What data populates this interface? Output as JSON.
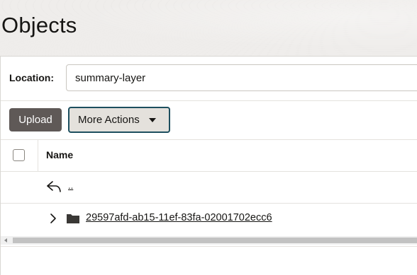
{
  "page": {
    "title": "Objects"
  },
  "location": {
    "label": "Location:",
    "value": "summary-layer"
  },
  "toolbar": {
    "upload_label": "Upload",
    "more_actions_label": "More Actions"
  },
  "table": {
    "columns": [
      "Name"
    ],
    "rows": [
      {
        "type": "parent",
        "name": ".."
      },
      {
        "type": "folder",
        "name": "29597afd-ab15-11ef-83fa-02001702ecc6"
      }
    ]
  },
  "icons": {
    "back": "back-arrow-icon",
    "expand": "chevron-right-icon",
    "folder": "folder-icon",
    "dropdown": "caret-down-icon"
  },
  "colors": {
    "primary_button": "#5f5957",
    "focus_outline": "#1d4f5f",
    "header_background": "#efedeb"
  }
}
